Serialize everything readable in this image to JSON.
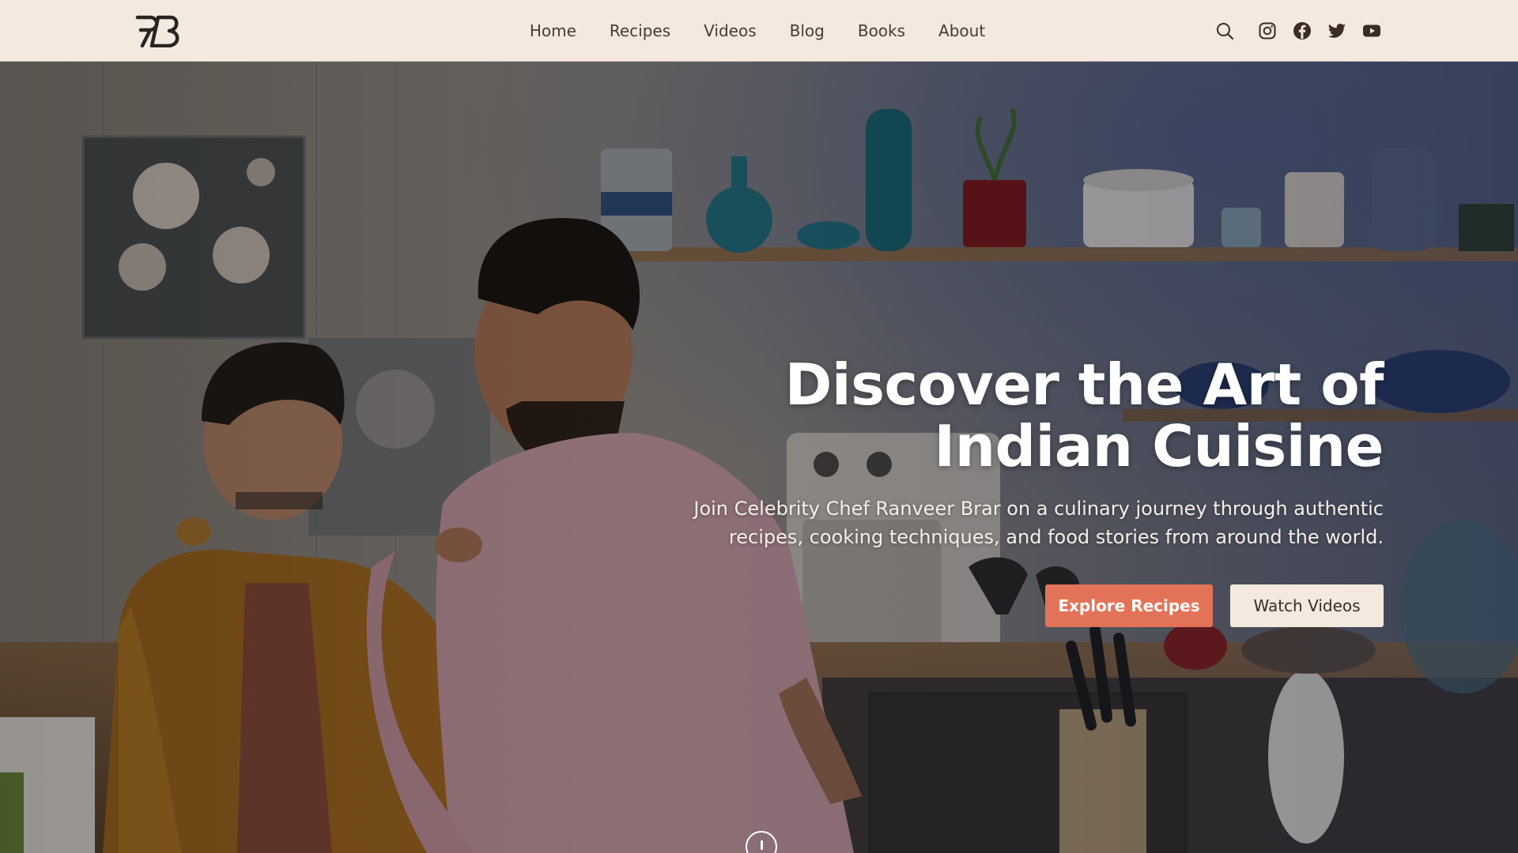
{
  "brand": {
    "logo_text": "RB"
  },
  "nav": {
    "links": [
      "Home",
      "Recipes",
      "Videos",
      "Blog",
      "Books",
      "About"
    ],
    "icons": [
      "search-icon",
      "instagram-icon",
      "facebook-icon",
      "twitter-icon",
      "youtube-icon"
    ]
  },
  "hero": {
    "title_line1": "Discover the Art of",
    "title_line2": "Indian Cuisine",
    "subtitle": "Join Celebrity Chef Ranveer Brar on a culinary journey through authentic recipes, cooking techniques, and food stories from around the world.",
    "primary_button": "Explore Recipes",
    "secondary_button": "Watch Videos"
  },
  "colors": {
    "nav_bg": "#f3e9df",
    "nav_text": "#4b3a30",
    "accent": "#e37358",
    "hero_text": "#ffffff"
  }
}
